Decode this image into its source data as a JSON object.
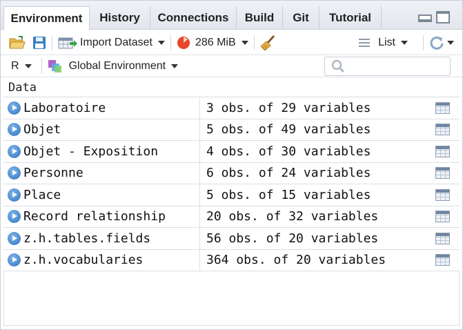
{
  "tabs": [
    {
      "label": "Environment",
      "active": true
    },
    {
      "label": "History"
    },
    {
      "label": "Connections"
    },
    {
      "label": "Build"
    },
    {
      "label": "Git"
    },
    {
      "label": "Tutorial"
    }
  ],
  "toolbar": {
    "import_label": "Import Dataset",
    "memory_label": "286 MiB",
    "view_label": "List"
  },
  "toolbar2": {
    "language": "R",
    "environment": "Global Environment",
    "search_placeholder": ""
  },
  "section_title": "Data",
  "rows": [
    {
      "name": "Laboratoire",
      "value": "3 obs. of 29 variables"
    },
    {
      "name": "Objet",
      "value": "5 obs. of 49 variables"
    },
    {
      "name": "Objet - Exposition",
      "value": "4 obs. of 30 variables"
    },
    {
      "name": "Personne",
      "value": "6 obs. of 24 variables"
    },
    {
      "name": "Place",
      "value": "5 obs. of 15 variables"
    },
    {
      "name": "Record relationship",
      "value": "20 obs. of 32 variables"
    },
    {
      "name": "z.h.tables.fields",
      "value": "56 obs. of 20 variables"
    },
    {
      "name": "z.h.vocabularies",
      "value": "364 obs. of 20 variables"
    }
  ],
  "colors": {
    "accent": "#2f73c0",
    "memory_icon": "#e8452c",
    "border": "#c9ced6"
  }
}
